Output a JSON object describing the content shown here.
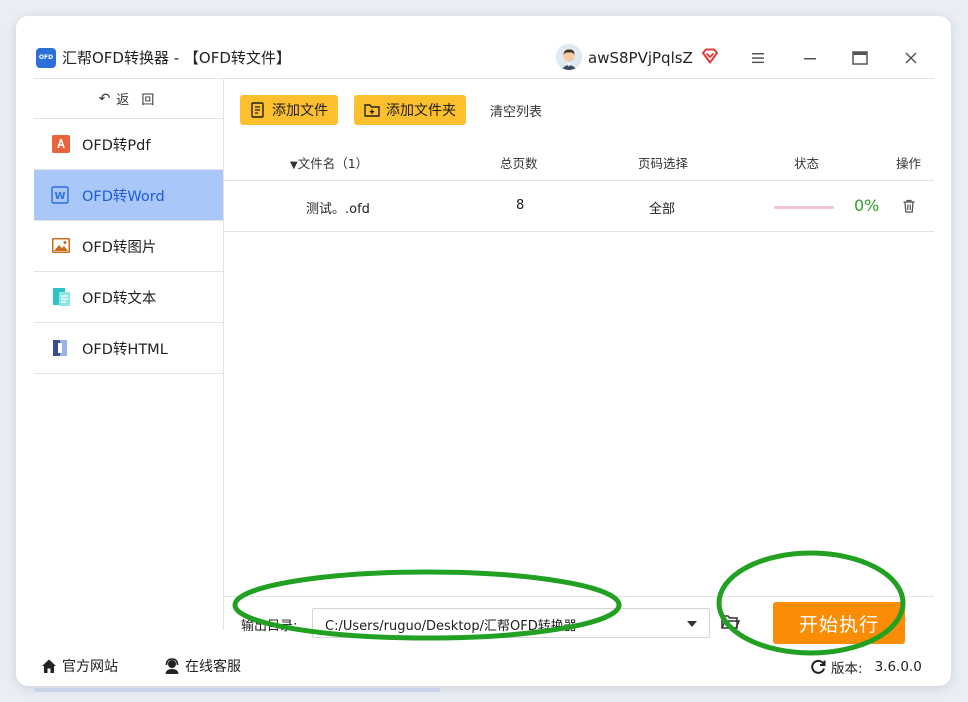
{
  "app": {
    "logo_text": "OFD",
    "title": "汇帮OFD转换器 - 【OFD转文件】",
    "username": "awS8PVjPqlsZ"
  },
  "window_controls": {
    "menu_icon": "hamburger-icon",
    "minimize_icon": "minimize-icon",
    "maximize_icon": "maximize-icon",
    "close_icon": "close-icon"
  },
  "sidebar": {
    "back_label": "返 回",
    "items": [
      {
        "label": "OFD转Pdf",
        "icon": "pdf-icon",
        "active": false
      },
      {
        "label": "OFD转Word",
        "icon": "word-icon",
        "active": true
      },
      {
        "label": "OFD转图片",
        "icon": "image-icon",
        "active": false
      },
      {
        "label": "OFD转文本",
        "icon": "text-icon",
        "active": false
      },
      {
        "label": "OFD转HTML",
        "icon": "html-icon",
        "active": false
      }
    ]
  },
  "toolbar": {
    "add_file": "添加文件",
    "add_folder": "添加文件夹",
    "clear_list": "清空列表"
  },
  "table": {
    "headers": {
      "filename": "文件名（1）",
      "pages": "总页数",
      "page_select": "页码选择",
      "status": "状态",
      "actions": "操作"
    },
    "rows": [
      {
        "filename": "测试。.ofd",
        "pages": "8",
        "page_select": "全部",
        "progress": 0,
        "percent": "0%"
      }
    ]
  },
  "output": {
    "label": "输出目录:",
    "path": "C:/Users/ruguo/Desktop/汇帮OFD转换器",
    "start_button": "开始执行"
  },
  "footer": {
    "website": "官方网站",
    "support": "在线客服",
    "version_label": "版本:",
    "version": "3.6.0.0"
  },
  "colors": {
    "accent_blue": "#1f5bd6",
    "active_bg": "#a9c8f9",
    "toolbar_button": "#fcbf2d",
    "start_button": "#fb8c05",
    "percent_green": "#2e9f2e",
    "annotation_green": "#22a022"
  }
}
